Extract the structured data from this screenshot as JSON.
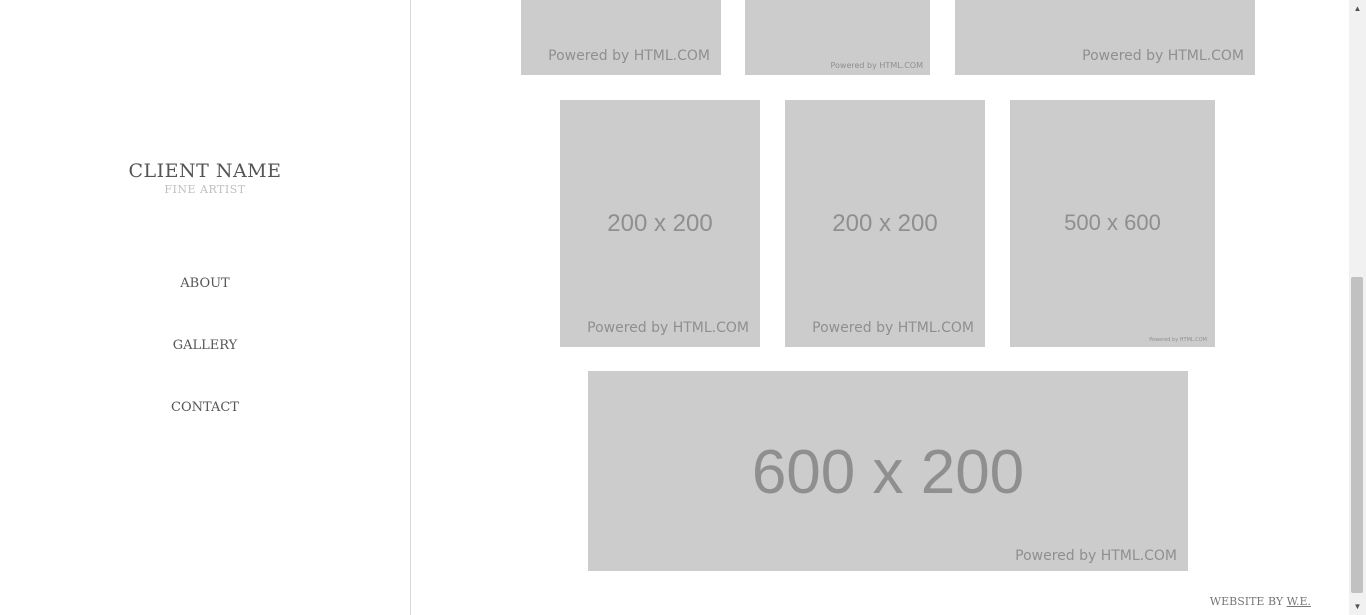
{
  "brand": {
    "name": "CLIENT NAME",
    "subtitle": "FINE ARTIST"
  },
  "nav": {
    "about": "ABOUT",
    "gallery": "GALLERY",
    "contact": "CONTACT"
  },
  "gallery": {
    "powered_text": "Powered by HTML.COM",
    "row2": [
      "200 x 200",
      "200 x 200",
      "500 x 600"
    ],
    "wide": "600 x 200"
  },
  "footer": {
    "prefix": "WEBSITE BY ",
    "link": "W.E."
  },
  "icons": {
    "scroll_up": "triangle-up",
    "scroll_down": "triangle-down"
  },
  "colors": {
    "placeholder_bg": "#cccccc",
    "placeholder_text": "#8f8f8f",
    "sidebar_border": "#d8d8d8"
  }
}
